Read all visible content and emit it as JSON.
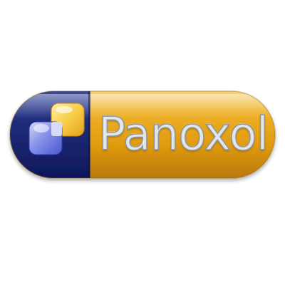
{
  "logo": {
    "brand_name": "Panoxol",
    "icon": "capsule-with-overlapping-squares-icon"
  },
  "colors": {
    "background": "#ffffff",
    "capsule_left_navy": "#1c2a73",
    "capsule_right_gold": "#e7a514",
    "square_yellow": "#f3c23a",
    "square_blue": "#6f7ee8",
    "text_silver": "#e3e6e8"
  }
}
